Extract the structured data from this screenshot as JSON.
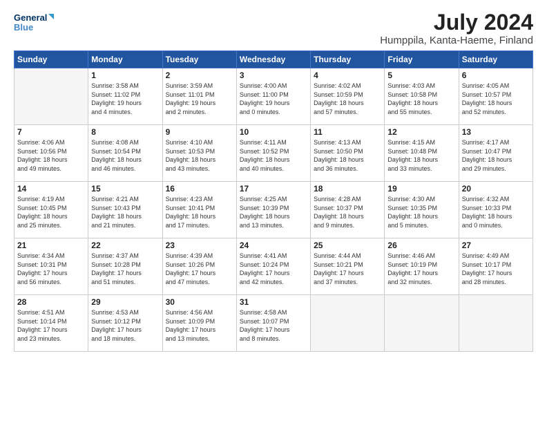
{
  "logo": {
    "line1": "General",
    "line2": "Blue"
  },
  "title": "July 2024",
  "location": "Humppila, Kanta-Haeme, Finland",
  "days_of_week": [
    "Sunday",
    "Monday",
    "Tuesday",
    "Wednesday",
    "Thursday",
    "Friday",
    "Saturday"
  ],
  "weeks": [
    [
      {
        "day": "",
        "info": ""
      },
      {
        "day": "1",
        "info": "Sunrise: 3:58 AM\nSunset: 11:02 PM\nDaylight: 19 hours\nand 4 minutes."
      },
      {
        "day": "2",
        "info": "Sunrise: 3:59 AM\nSunset: 11:01 PM\nDaylight: 19 hours\nand 2 minutes."
      },
      {
        "day": "3",
        "info": "Sunrise: 4:00 AM\nSunset: 11:00 PM\nDaylight: 19 hours\nand 0 minutes."
      },
      {
        "day": "4",
        "info": "Sunrise: 4:02 AM\nSunset: 10:59 PM\nDaylight: 18 hours\nand 57 minutes."
      },
      {
        "day": "5",
        "info": "Sunrise: 4:03 AM\nSunset: 10:58 PM\nDaylight: 18 hours\nand 55 minutes."
      },
      {
        "day": "6",
        "info": "Sunrise: 4:05 AM\nSunset: 10:57 PM\nDaylight: 18 hours\nand 52 minutes."
      }
    ],
    [
      {
        "day": "7",
        "info": "Sunrise: 4:06 AM\nSunset: 10:56 PM\nDaylight: 18 hours\nand 49 minutes."
      },
      {
        "day": "8",
        "info": "Sunrise: 4:08 AM\nSunset: 10:54 PM\nDaylight: 18 hours\nand 46 minutes."
      },
      {
        "day": "9",
        "info": "Sunrise: 4:10 AM\nSunset: 10:53 PM\nDaylight: 18 hours\nand 43 minutes."
      },
      {
        "day": "10",
        "info": "Sunrise: 4:11 AM\nSunset: 10:52 PM\nDaylight: 18 hours\nand 40 minutes."
      },
      {
        "day": "11",
        "info": "Sunrise: 4:13 AM\nSunset: 10:50 PM\nDaylight: 18 hours\nand 36 minutes."
      },
      {
        "day": "12",
        "info": "Sunrise: 4:15 AM\nSunset: 10:48 PM\nDaylight: 18 hours\nand 33 minutes."
      },
      {
        "day": "13",
        "info": "Sunrise: 4:17 AM\nSunset: 10:47 PM\nDaylight: 18 hours\nand 29 minutes."
      }
    ],
    [
      {
        "day": "14",
        "info": "Sunrise: 4:19 AM\nSunset: 10:45 PM\nDaylight: 18 hours\nand 25 minutes."
      },
      {
        "day": "15",
        "info": "Sunrise: 4:21 AM\nSunset: 10:43 PM\nDaylight: 18 hours\nand 21 minutes."
      },
      {
        "day": "16",
        "info": "Sunrise: 4:23 AM\nSunset: 10:41 PM\nDaylight: 18 hours\nand 17 minutes."
      },
      {
        "day": "17",
        "info": "Sunrise: 4:25 AM\nSunset: 10:39 PM\nDaylight: 18 hours\nand 13 minutes."
      },
      {
        "day": "18",
        "info": "Sunrise: 4:28 AM\nSunset: 10:37 PM\nDaylight: 18 hours\nand 9 minutes."
      },
      {
        "day": "19",
        "info": "Sunrise: 4:30 AM\nSunset: 10:35 PM\nDaylight: 18 hours\nand 5 minutes."
      },
      {
        "day": "20",
        "info": "Sunrise: 4:32 AM\nSunset: 10:33 PM\nDaylight: 18 hours\nand 0 minutes."
      }
    ],
    [
      {
        "day": "21",
        "info": "Sunrise: 4:34 AM\nSunset: 10:31 PM\nDaylight: 17 hours\nand 56 minutes."
      },
      {
        "day": "22",
        "info": "Sunrise: 4:37 AM\nSunset: 10:28 PM\nDaylight: 17 hours\nand 51 minutes."
      },
      {
        "day": "23",
        "info": "Sunrise: 4:39 AM\nSunset: 10:26 PM\nDaylight: 17 hours\nand 47 minutes."
      },
      {
        "day": "24",
        "info": "Sunrise: 4:41 AM\nSunset: 10:24 PM\nDaylight: 17 hours\nand 42 minutes."
      },
      {
        "day": "25",
        "info": "Sunrise: 4:44 AM\nSunset: 10:21 PM\nDaylight: 17 hours\nand 37 minutes."
      },
      {
        "day": "26",
        "info": "Sunrise: 4:46 AM\nSunset: 10:19 PM\nDaylight: 17 hours\nand 32 minutes."
      },
      {
        "day": "27",
        "info": "Sunrise: 4:49 AM\nSunset: 10:17 PM\nDaylight: 17 hours\nand 28 minutes."
      }
    ],
    [
      {
        "day": "28",
        "info": "Sunrise: 4:51 AM\nSunset: 10:14 PM\nDaylight: 17 hours\nand 23 minutes."
      },
      {
        "day": "29",
        "info": "Sunrise: 4:53 AM\nSunset: 10:12 PM\nDaylight: 17 hours\nand 18 minutes."
      },
      {
        "day": "30",
        "info": "Sunrise: 4:56 AM\nSunset: 10:09 PM\nDaylight: 17 hours\nand 13 minutes."
      },
      {
        "day": "31",
        "info": "Sunrise: 4:58 AM\nSunset: 10:07 PM\nDaylight: 17 hours\nand 8 minutes."
      },
      {
        "day": "",
        "info": ""
      },
      {
        "day": "",
        "info": ""
      },
      {
        "day": "",
        "info": ""
      }
    ]
  ]
}
